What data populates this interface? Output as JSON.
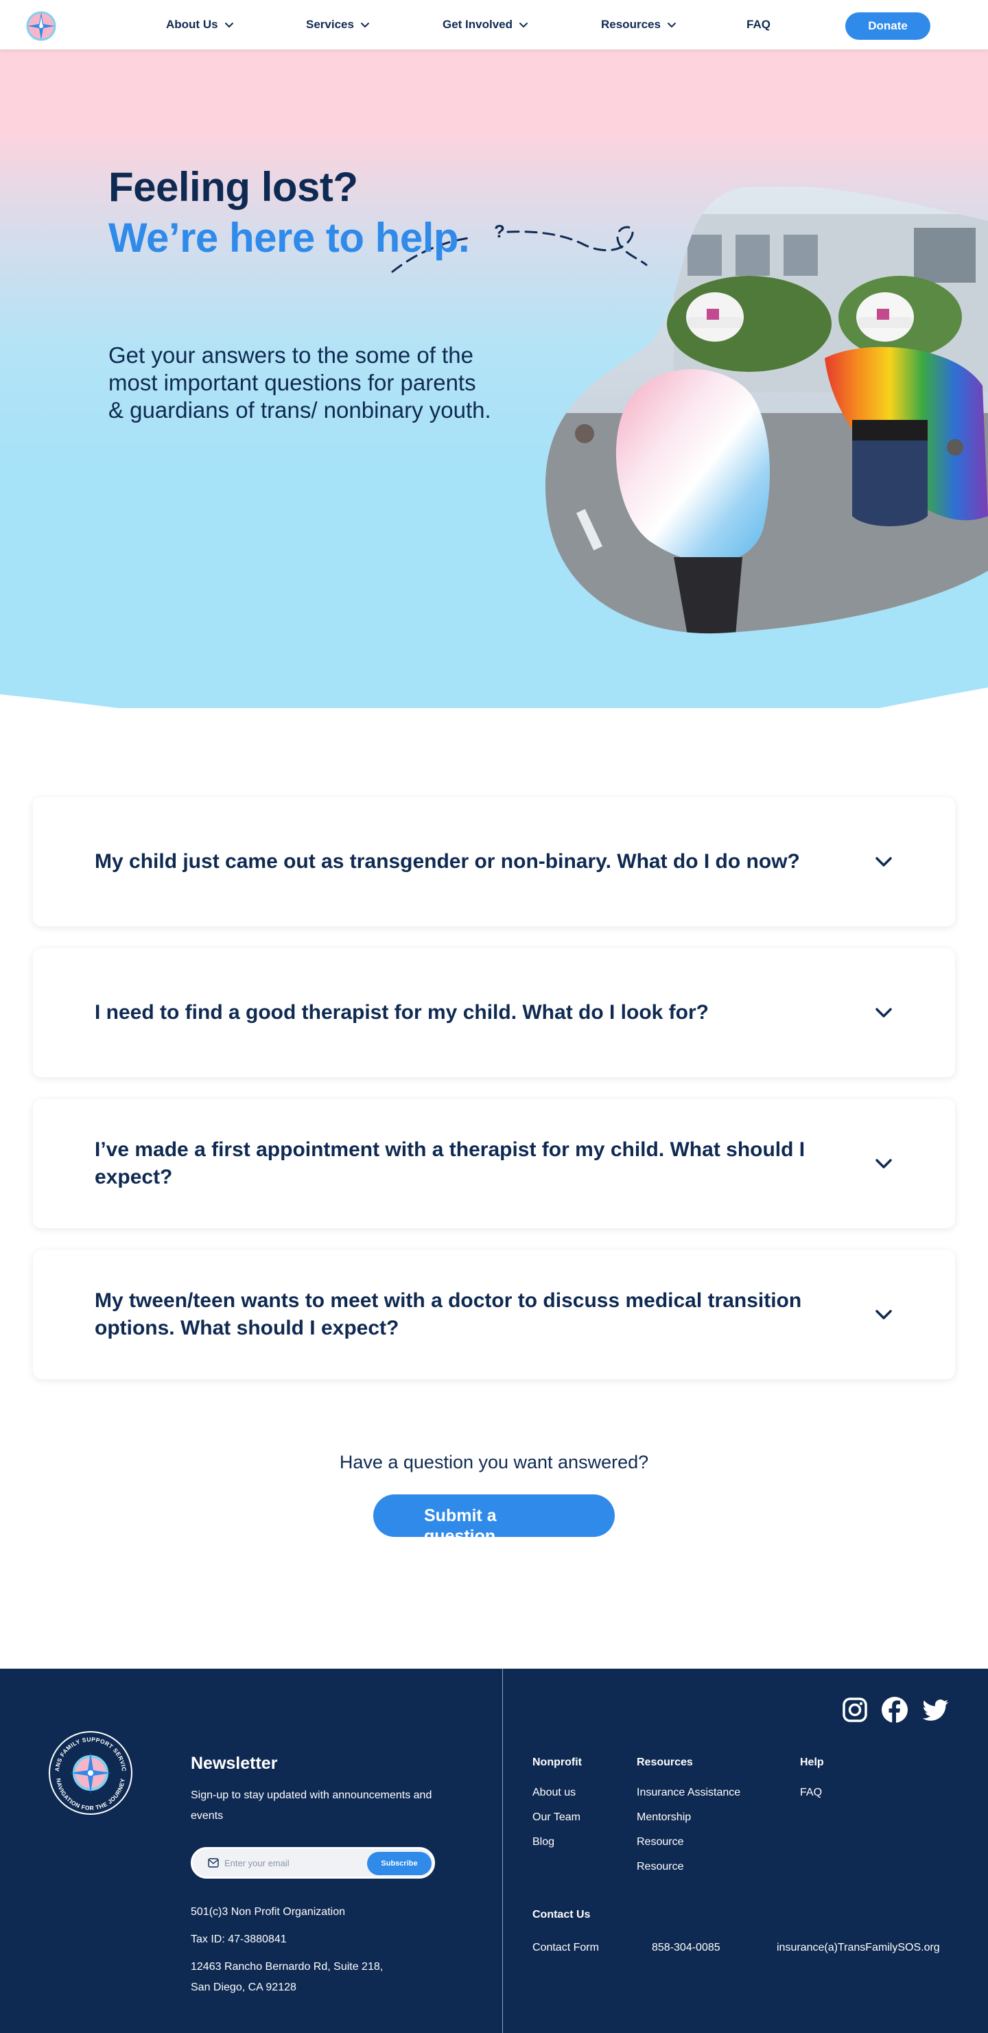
{
  "nav": {
    "items": [
      {
        "label": "About Us",
        "dropdown": true
      },
      {
        "label": "Services",
        "dropdown": true
      },
      {
        "label": "Get Involved",
        "dropdown": true
      },
      {
        "label": "Resources",
        "dropdown": true
      },
      {
        "label": "FAQ",
        "dropdown": false
      }
    ],
    "donate_label": "Donate"
  },
  "hero": {
    "title_line1": "Feeling lost?",
    "title_line2": "We’re here to help.",
    "subtitle": "Get your answers to the some of the most important questions for parents & guardians of trans/ nonbinary youth."
  },
  "faq": {
    "questions": [
      "My child just came out as transgender or non-binary. What do I do now?",
      "I need to find a good therapist for my child. What do I look for?",
      "I’ve made a first appointment with a therapist for my child. What should I expect?",
      "My tween/teen wants to meet with a doctor to discuss medical transition options. What should I expect?"
    ],
    "ask_text": "Have a question you want answered?",
    "submit_label": "Submit a question"
  },
  "footer": {
    "newsletter": {
      "title": "Newsletter",
      "subtitle": "Sign-up to stay updated with announcements and events",
      "email_placeholder": "Enter your email",
      "subscribe_label": "Subscribe"
    },
    "org_type": "501(c)3 Non Profit Organization",
    "tax_id": "Tax ID: 47-3880841",
    "address": "12463 Rancho Bernardo Rd, Suite 218, San Diego, CA 92128",
    "seal_text_top": "TRANS FAMILY SUPPORT SERVICES",
    "seal_text_bottom": "NAVIGATION FOR THE JOURNEY",
    "social": [
      "instagram-icon",
      "facebook-icon",
      "twitter-icon"
    ],
    "columns": {
      "nonprofit": {
        "heading": "Nonprofit",
        "links": [
          "About us",
          "Our Team",
          "Blog"
        ]
      },
      "resources": {
        "heading": "Resources",
        "links": [
          "Insurance Assistance",
          "Mentorship",
          "Resource",
          "Resource"
        ]
      },
      "help": {
        "heading": "Help",
        "links": [
          "FAQ"
        ]
      }
    },
    "contact": {
      "heading": "Contact Us",
      "form_label": "Contact Form",
      "phone": "858-304-0085",
      "email": "insurance(a)TransFamilySOS.org"
    }
  },
  "colors": {
    "navy": "#0f2a52",
    "accent_blue": "#2f8ae9",
    "hero_pink": "#fdd4de",
    "hero_blue": "#a6e2f8"
  }
}
